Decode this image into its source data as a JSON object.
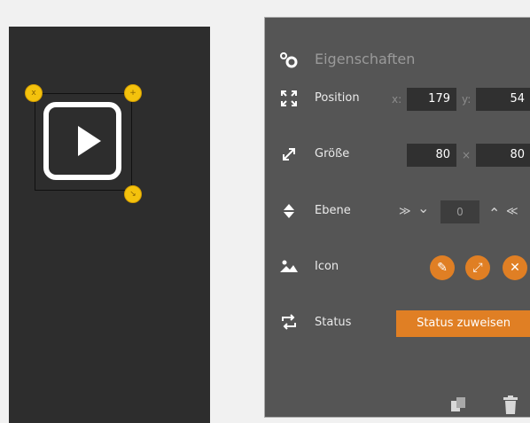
{
  "canvas": {
    "handles": [
      "x",
      "+",
      "↘"
    ]
  },
  "panel": {
    "title": "Eigenschaften",
    "position": {
      "label": "Position",
      "x_axis": "x:",
      "x_value": "179",
      "y_axis": "y:",
      "y_value": "54"
    },
    "size": {
      "label": "Größe",
      "width": "80",
      "times": "×",
      "height": "80"
    },
    "layer": {
      "label": "Ebene",
      "value": "0",
      "down_all": "≫",
      "down": "⌄",
      "up": "⌃",
      "up_all": "≪"
    },
    "icon": {
      "label": "Icon",
      "edit_glyph": "✎",
      "resize_glyph": "⤢",
      "remove_glyph": "✕"
    },
    "status": {
      "label": "Status",
      "button": "Status zuweisen"
    }
  },
  "icons": {
    "gear": "gear-icon",
    "position": "move-arrows-icon",
    "size": "resize-arrows-icon",
    "layer": "updown-icon",
    "image": "image-icon",
    "status": "repeat-icon",
    "duplicate": "copy-icon",
    "delete": "trash-icon"
  },
  "colors": {
    "accent": "#e07f24",
    "handle": "#f4c20d",
    "panel": "#555555",
    "canvas": "#2d2d2d"
  }
}
